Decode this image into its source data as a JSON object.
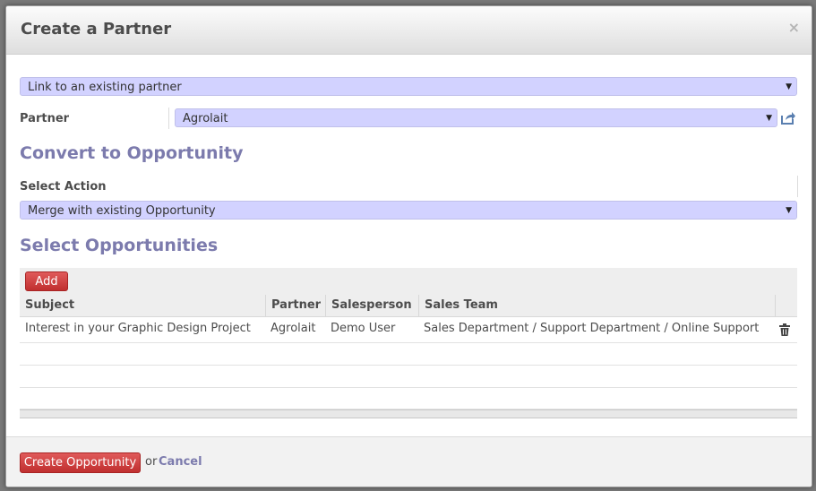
{
  "dialog": {
    "title": "Create a Partner",
    "close_label": "×"
  },
  "action_select": {
    "value": "Link to an existing partner"
  },
  "partner": {
    "label": "Partner",
    "value": "Agrolait"
  },
  "convert_section": {
    "title": "Convert to Opportunity"
  },
  "select_action": {
    "label": "Select Action",
    "value": "Merge with existing Opportunity"
  },
  "opportunities_section": {
    "title": "Select Opportunities"
  },
  "list": {
    "add_label": "Add",
    "columns": [
      "Subject",
      "Partner",
      "Salesperson",
      "Sales Team"
    ],
    "rows": [
      {
        "subject": "Interest in your Graphic Design Project",
        "partner": "Agrolait",
        "salesperson": "Demo User",
        "sales_team": "Sales Department / Support Department / Online Support"
      }
    ]
  },
  "footer": {
    "create_label": "Create Opportunity",
    "or_text": "or",
    "cancel_label": "Cancel"
  },
  "colors": {
    "accent": "#7c7bad",
    "select_bg": "#d2d2ff",
    "button_red": "#c9403f"
  }
}
